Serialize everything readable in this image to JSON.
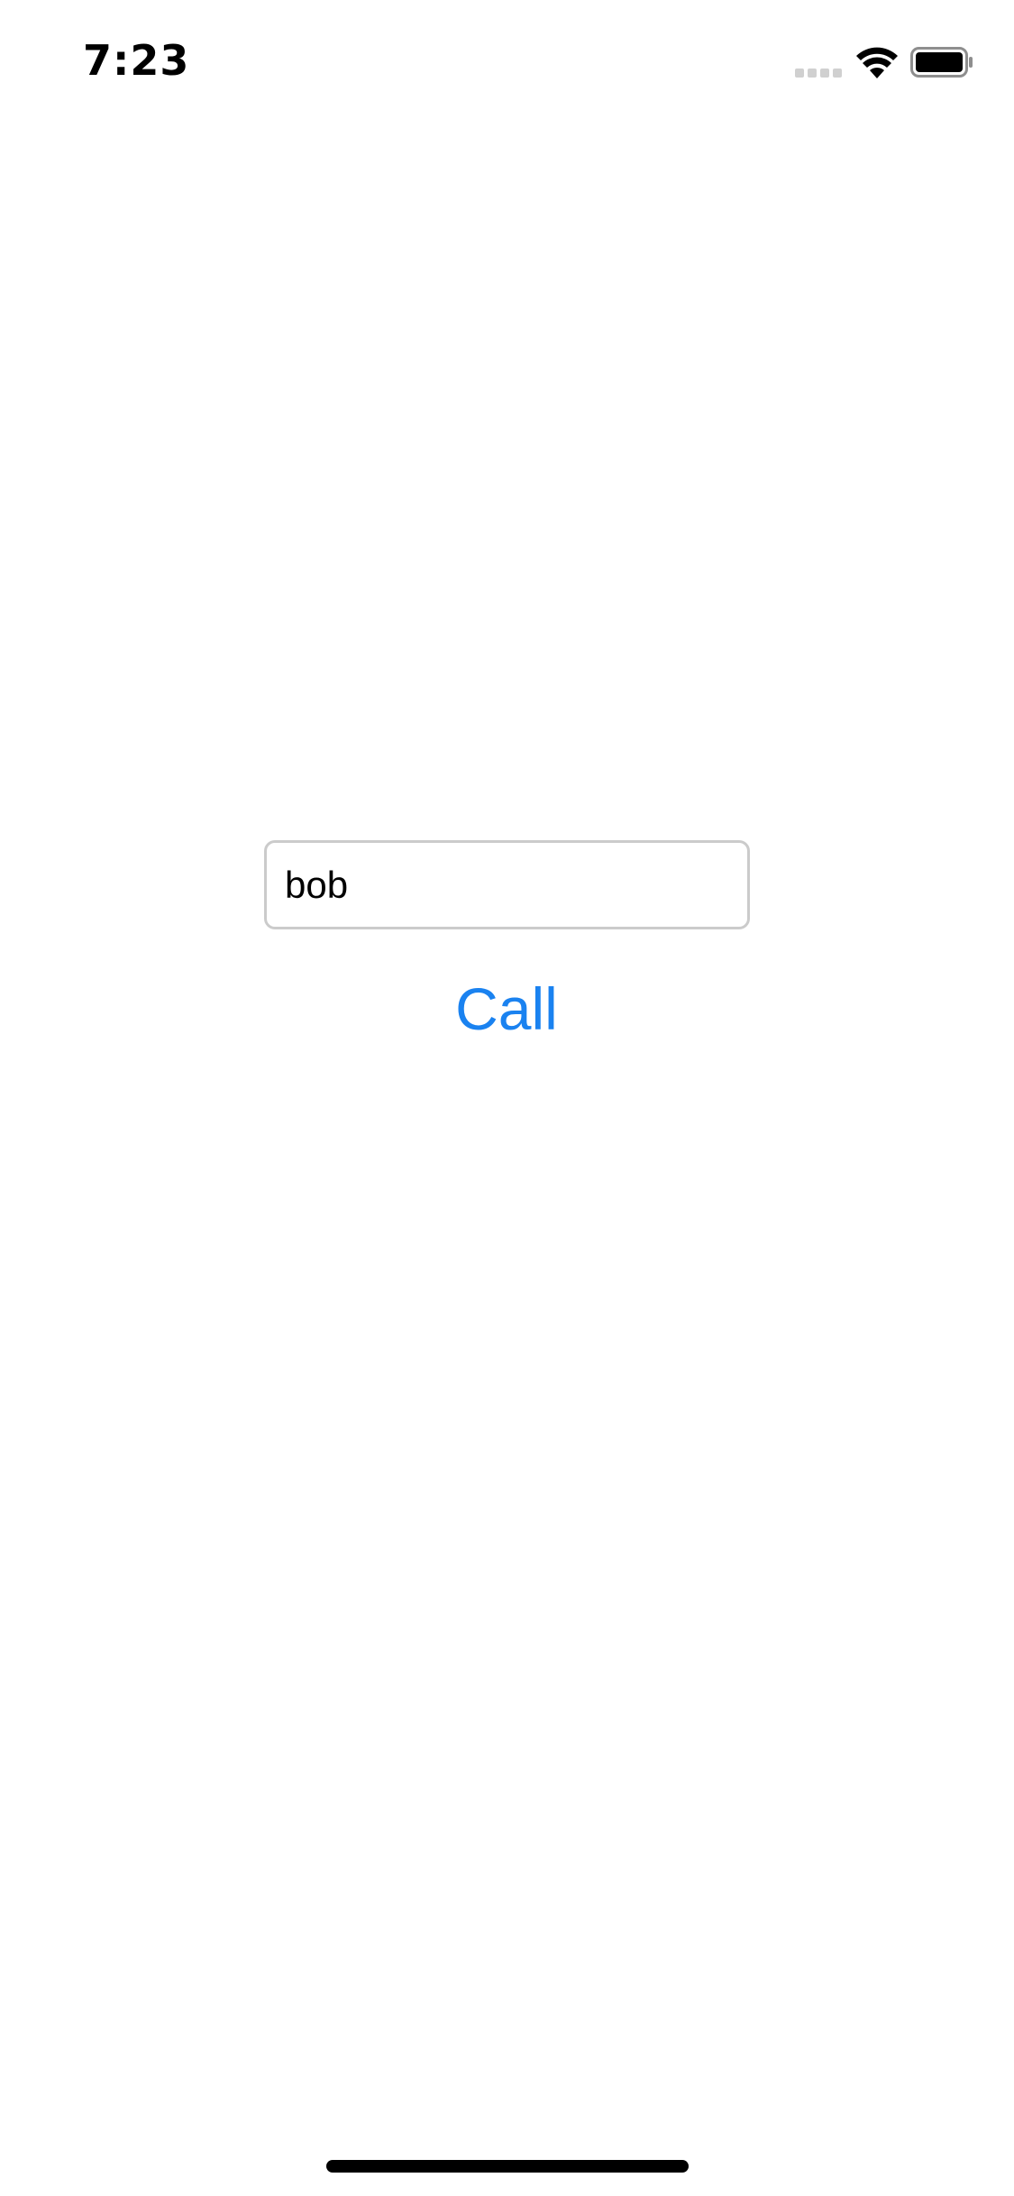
{
  "status_bar": {
    "time": "7:23",
    "icons": [
      "signal-icon",
      "wifi-icon",
      "battery-icon"
    ]
  },
  "form": {
    "name_field": {
      "value": "bob",
      "placeholder": ""
    },
    "call_button": {
      "label": "Call"
    }
  },
  "colors": {
    "accent": "#1a82f0",
    "field_border": "#cbcbcb",
    "background": "#ffffff"
  }
}
